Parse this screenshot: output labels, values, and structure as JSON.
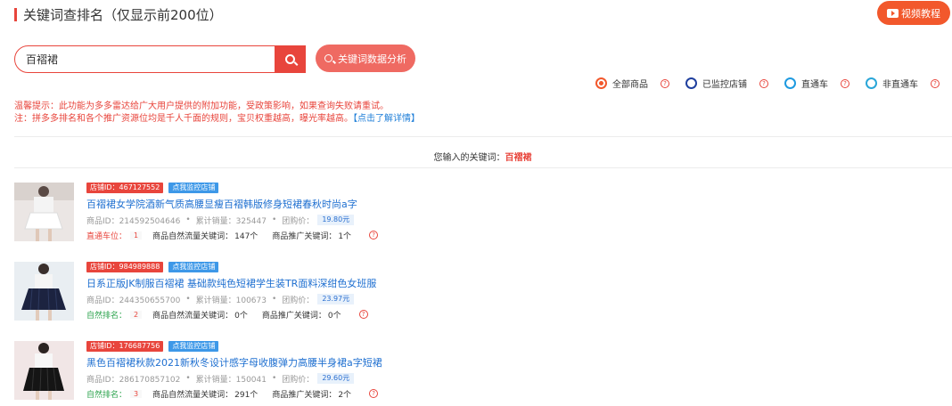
{
  "header": {
    "title": "关键词查排名（仅显示前200位）",
    "video_button": "视频教程"
  },
  "search": {
    "value": "百褶裙",
    "analysis_button": "关键词数据分析"
  },
  "filters": [
    {
      "label": "全部商品",
      "color": "#f2582c",
      "checked": true
    },
    {
      "label": "已监控店铺",
      "color": "#1f3f9e",
      "checked": false
    },
    {
      "label": "直通车",
      "color": "#1e9ae0",
      "checked": false
    },
    {
      "label": "非直通车",
      "color": "#2aa6d8",
      "checked": false
    }
  ],
  "help_glyph": "?",
  "tips": {
    "line1": "温馨提示：此功能为多多雷达给广大用户提供的附加功能，受政策影响，如果查询失败请重试。",
    "line2": "注：拼多多排名和各个推广资源位均是千人千面的规则，宝贝权重越高，曝光率越高。",
    "line2_link": "【点击了解详情】"
  },
  "keyword": {
    "label": "您输入的关键词：",
    "value": "百褶裙"
  },
  "items": [
    {
      "shop_id": "店铺ID：467127552",
      "monitor": "点我监控店铺",
      "title": "百褶裙女学院酒新气质高腰显瘦百褶韩版修身短裙春秋时尚a字",
      "goods_id": "商品ID：214592504646",
      "sales": "累计销量：325447",
      "group_price_label": "团购价：",
      "group_price": "19.80元",
      "rank_label": "直通车位：",
      "rank_num": "1",
      "natural_kw_label": "商品自然流量关键词：",
      "natural_kw": "147个",
      "promo_kw_label": "商品推广关键词：",
      "promo_kw": "1个"
    },
    {
      "shop_id": "店铺ID：984989888",
      "monitor": "点我监控店铺",
      "title": "日系正版JK制服百褶裙 基础款纯色短裙学生装TR面料深绀色女班服",
      "goods_id": "商品ID：244350655700",
      "sales": "累计销量：100673",
      "group_price_label": "团购价：",
      "group_price": "23.97元",
      "rank_label": "自然排名：",
      "rank_num": "2",
      "natural_kw_label": "商品自然流量关键词：",
      "natural_kw": "0个",
      "promo_kw_label": "商品推广关键词：",
      "promo_kw": "0个"
    },
    {
      "shop_id": "店铺ID：176687756",
      "monitor": "点我监控店铺",
      "title": "黑色百褶裙秋款2021新秋冬设计感字母收腹弹力高腰半身裙a字短裙",
      "goods_id": "商品ID：286170857102",
      "sales": "累计销量：150041",
      "group_price_label": "团购价：",
      "group_price": "29.60元",
      "rank_label": "自然排名：",
      "rank_num": "3",
      "natural_kw_label": "商品自然流量关键词：",
      "natural_kw": "291个",
      "promo_kw_label": "商品推广关键词：",
      "promo_kw": "2个"
    }
  ],
  "colors": {
    "accent": "#e8453c",
    "link": "#1e6fd0",
    "badge_blue": "#3d98e8",
    "rank_green": "#2ea44f"
  }
}
